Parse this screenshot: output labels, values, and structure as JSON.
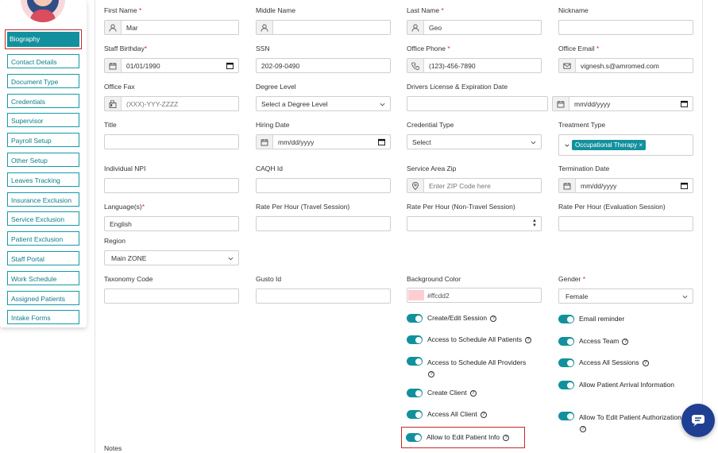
{
  "sidebar": {
    "items": [
      {
        "label": "Biography"
      },
      {
        "label": "Contact Details"
      },
      {
        "label": "Document Type"
      },
      {
        "label": "Credentials"
      },
      {
        "label": "Supervisor"
      },
      {
        "label": "Payroll Setup"
      },
      {
        "label": "Other Setup"
      },
      {
        "label": "Leaves Tracking"
      },
      {
        "label": "Insurance Exclusion"
      },
      {
        "label": "Service Exclusion"
      },
      {
        "label": "Patient Exclusion"
      },
      {
        "label": "Staff Portal"
      },
      {
        "label": "Work Schedule"
      },
      {
        "label": "Assigned Patients"
      },
      {
        "label": "Intake Forms"
      }
    ],
    "active_index": 0
  },
  "form": {
    "first_name": {
      "label": "First Name",
      "value": "Mar"
    },
    "middle_name": {
      "label": "Middle Name",
      "value": ""
    },
    "last_name": {
      "label": "Last Name",
      "value": "Geo"
    },
    "nickname": {
      "label": "Nickname",
      "value": ""
    },
    "staff_birthday": {
      "label": "Staff Birthday",
      "value": "01/01/1990"
    },
    "ssn": {
      "label": "SSN",
      "value": "202-09-0490"
    },
    "office_phone": {
      "label": "Office Phone",
      "value": "(123)-456-7890"
    },
    "office_email": {
      "label": "Office Email",
      "value": "vignesh.s@amromed.com"
    },
    "office_fax": {
      "label": "Office Fax",
      "placeholder": "(XXX)-YYY-ZZZZ"
    },
    "degree_level": {
      "label": "Degree Level",
      "value": "Select a Degree Level"
    },
    "drivers_license": {
      "label": "Drivers License & Expiration Date",
      "value": "",
      "date_placeholder": "mm/dd/yyyy"
    },
    "title": {
      "label": "Title",
      "value": ""
    },
    "hiring_date": {
      "label": "Hiring Date",
      "placeholder": "mm/dd/yyyy"
    },
    "credential_type": {
      "label": "Credential Type",
      "value": "Select"
    },
    "treatment_type": {
      "label": "Treatment Type",
      "tag": "Occupational Therapy",
      "tag_remove": "×"
    },
    "individual_npi": {
      "label": "Individual NPI",
      "value": ""
    },
    "caqh_id": {
      "label": "CAQH Id",
      "value": ""
    },
    "service_area_zip": {
      "label": "Service Area Zip",
      "placeholder": "Enter ZIP Code here"
    },
    "termination_date": {
      "label": "Termination Date",
      "placeholder": "mm/dd/yyyy"
    },
    "languages": {
      "label": "Language(s)",
      "value": "English"
    },
    "rate_travel": {
      "label": "Rate Per Hour (Travel Session)",
      "value": ""
    },
    "rate_non_travel": {
      "label": "Rate Per Hour (Non-Travel Session)",
      "value": ""
    },
    "rate_evaluation": {
      "label": "Rate Per Hour (Evaluation Session)",
      "value": ""
    },
    "region": {
      "label": "Region",
      "value": "Main ZONE"
    },
    "taxonomy_code": {
      "label": "Taxonomy Code",
      "value": ""
    },
    "gusto_id": {
      "label": "Gusto Id",
      "value": ""
    },
    "background_color": {
      "label": "Background Color",
      "value": "#ffcdd2"
    },
    "gender": {
      "label": "Gender",
      "value": "Female"
    },
    "notes": {
      "label": "Notes"
    }
  },
  "required_mark": "*",
  "help_glyph": "?",
  "toggles_left": [
    {
      "label": "Create/Edit Session",
      "on": true
    },
    {
      "label": "Access to Schedule All Patients",
      "on": true
    },
    {
      "label": "Access to Schedule All Providers",
      "on": true
    },
    {
      "label": "Create Client",
      "on": true
    },
    {
      "label": "Access All Client",
      "on": true
    },
    {
      "label": "Allow to Edit Patient Info",
      "on": true
    }
  ],
  "toggles_right": [
    {
      "label": "Email reminder",
      "on": true
    },
    {
      "label": "Access Team",
      "on": true
    },
    {
      "label": "Access All Sessions",
      "on": true
    },
    {
      "label": "Allow Patient Arrival Information",
      "on": true
    },
    {
      "label": "Allow To Edit Patient Authorization",
      "on": true
    }
  ],
  "colors": {
    "accent": "#13909d",
    "highlight": "#c62828",
    "chat": "#1f3f93"
  },
  "icons": {
    "chat": "chat-bubble-icon"
  }
}
